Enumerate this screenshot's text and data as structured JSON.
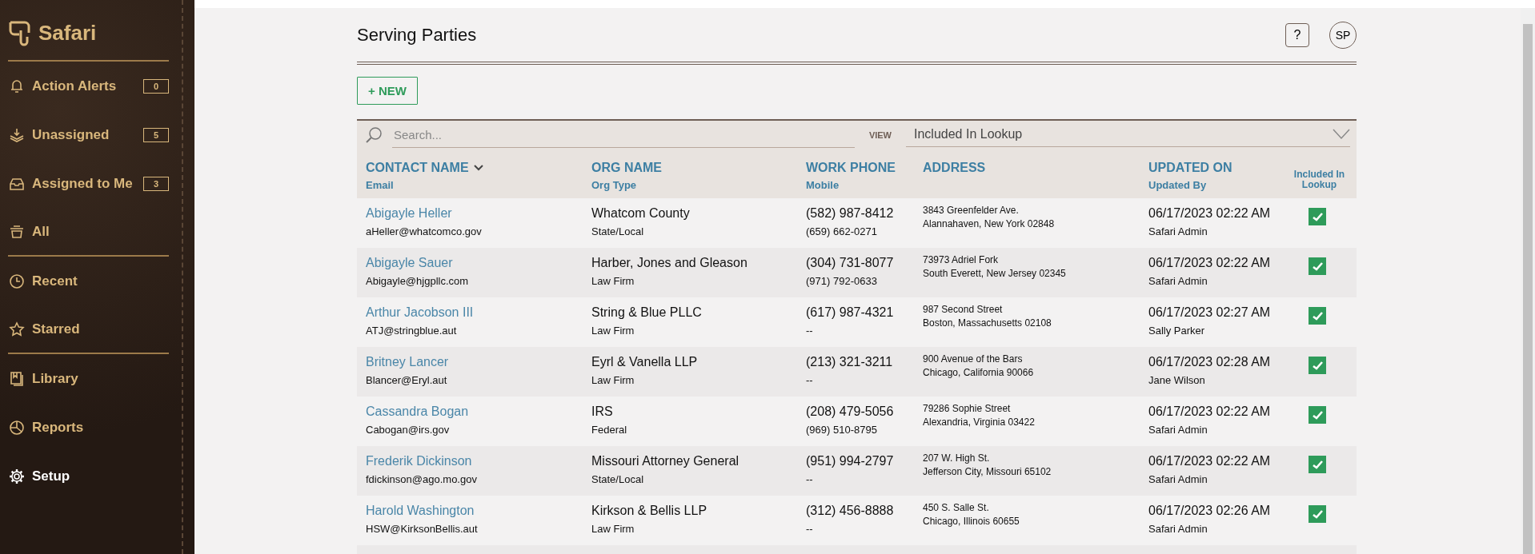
{
  "sidebar": {
    "logo": "Safari",
    "groups": [
      [
        {
          "label": "Action Alerts",
          "count": "0",
          "selected": false
        },
        {
          "label": "Unassigned",
          "count": "5",
          "selected": false
        },
        {
          "label": "Assigned to Me",
          "count": "3",
          "selected": false
        },
        {
          "label": "All",
          "selected": false
        }
      ],
      [
        {
          "label": "Recent",
          "selected": false
        },
        {
          "label": "Starred",
          "selected": false
        }
      ],
      [
        {
          "label": "Library",
          "selected": false
        },
        {
          "label": "Reports",
          "selected": false
        },
        {
          "label": "Setup",
          "selected": true
        }
      ]
    ]
  },
  "header": {
    "title": "Serving Parties",
    "help": "?",
    "avatar": "SP"
  },
  "new_button": "+ NEW",
  "search": {
    "placeholder": "Search...",
    "view_label": "VIEW",
    "view_value": "Included In Lookup"
  },
  "table": {
    "columns": [
      {
        "title": "CONTACT NAME",
        "subtitle": "Email",
        "sorted": true
      },
      {
        "title": "ORG NAME",
        "subtitle": "Org Type",
        "sorted": false
      },
      {
        "title": "WORK PHONE",
        "subtitle": "Mobile",
        "sorted": false
      },
      {
        "title": "ADDRESS",
        "sorted": false
      },
      {
        "title": "UPDATED ON",
        "subtitle": "Updated By",
        "sorted": false
      },
      {
        "title": "Included In Lookup",
        "sorted": false
      }
    ],
    "rows": [
      {
        "name": "Abigayle Heller",
        "email": "aHeller@whatcomco.gov",
        "org": "Whatcom County",
        "org_type": "State/Local",
        "phone": "(582) 987-8412",
        "mobile": "(659) 662-0271",
        "address1": "3843 Greenfelder Ave.",
        "address2": "Alannahaven, New York 02848",
        "updated_on": "06/17/2023 02:22 AM",
        "updated_by": "Safari Admin",
        "included": true
      },
      {
        "name": "Abigayle Sauer",
        "email": "Abigayle@hjgpllc.com",
        "org": "Harber, Jones and Gleason",
        "org_type": "Law Firm",
        "phone": "(304) 731-8077",
        "mobile": "(971) 792-0633",
        "address1": "73973 Adriel Fork",
        "address2": "South Everett, New Jersey 02345",
        "updated_on": "06/17/2023 02:22 AM",
        "updated_by": "Safari Admin",
        "included": true
      },
      {
        "name": "Arthur Jacobson III",
        "email": "ATJ@stringblue.aut",
        "org": "String & Blue PLLC",
        "org_type": "Law Firm",
        "phone": "(617) 987-4321",
        "mobile": "--",
        "address1": "987 Second Street",
        "address2": "Boston, Massachusetts 02108",
        "updated_on": "06/17/2023 02:27 AM",
        "updated_by": "Sally Parker",
        "included": true
      },
      {
        "name": "Britney Lancer",
        "email": "Blancer@Eryl.aut",
        "org": "Eyrl & Vanella LLP",
        "org_type": "Law Firm",
        "phone": "(213) 321-3211",
        "mobile": "--",
        "address1": "900 Avenue of the Bars",
        "address2": "Chicago, California 90066",
        "updated_on": "06/17/2023 02:28 AM",
        "updated_by": "Jane Wilson",
        "included": true
      },
      {
        "name": "Cassandra Bogan",
        "email": "Cabogan@irs.gov",
        "org": "IRS",
        "org_type": "Federal",
        "phone": "(208) 479-5056",
        "mobile": "(969) 510-8795",
        "address1": "79286 Sophie Street",
        "address2": "Alexandria, Virginia 03422",
        "updated_on": "06/17/2023 02:22 AM",
        "updated_by": "Safari Admin",
        "included": true
      },
      {
        "name": "Frederik Dickinson",
        "email": "fdickinson@ago.mo.gov",
        "org": "Missouri Attorney General",
        "org_type": "State/Local",
        "phone": "(951) 994-2797",
        "mobile": "--",
        "address1": "207 W. High St.",
        "address2": "Jefferson City, Missouri 65102",
        "updated_on": "06/17/2023 02:22 AM",
        "updated_by": "Safari Admin",
        "included": true
      },
      {
        "name": "Harold Washington",
        "email": "HSW@KirksonBellis.aut",
        "org": "Kirkson & Bellis LLP",
        "org_type": "Law Firm",
        "phone": "(312) 456-8888",
        "mobile": "--",
        "address1": "450 S. Salle St.",
        "address2": "Chicago, Illinois 60655",
        "updated_on": "06/17/2023 02:26 AM",
        "updated_by": "Safari Admin",
        "included": true
      }
    ]
  }
}
